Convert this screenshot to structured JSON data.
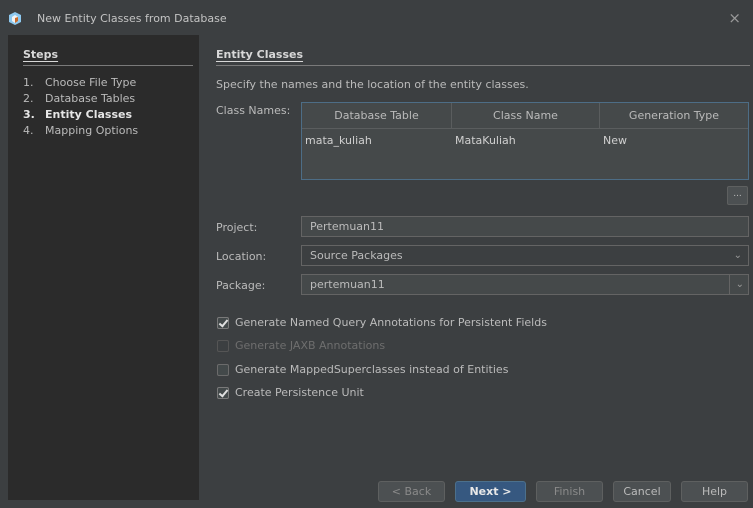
{
  "window": {
    "title": "New Entity Classes from Database",
    "close_icon": "×"
  },
  "steps": {
    "header": "Steps",
    "items": [
      {
        "num": "1.",
        "label": "Choose File Type"
      },
      {
        "num": "2.",
        "label": "Database Tables"
      },
      {
        "num": "3.",
        "label": "Entity Classes"
      },
      {
        "num": "4.",
        "label": "Mapping Options"
      }
    ]
  },
  "main": {
    "header": "Entity Classes",
    "description": "Specify the names and the location of the entity classes.",
    "class_names_label": "Class Names:",
    "table": {
      "columns": [
        "Database Table",
        "Class Name",
        "Generation Type"
      ],
      "rows": [
        {
          "table": "mata_kuliah",
          "class": "MataKuliah",
          "type": "New"
        }
      ]
    },
    "ellipsis_button": "...",
    "project_label": "Project:",
    "project_value": "Pertemuan11",
    "location_label": "Location:",
    "location_value": "Source Packages",
    "package_label": "Package:",
    "package_value": "pertemuan11",
    "checkboxes": [
      {
        "label": "Generate Named Query Annotations for Persistent Fields",
        "checked": true,
        "enabled": true
      },
      {
        "label": "Generate JAXB Annotations",
        "checked": false,
        "enabled": false
      },
      {
        "label": "Generate MappedSuperclasses instead of Entities",
        "checked": false,
        "enabled": true
      },
      {
        "label": "Create Persistence Unit",
        "checked": true,
        "enabled": true
      }
    ]
  },
  "buttons": {
    "back": "< Back",
    "next": "Next >",
    "finish": "Finish",
    "cancel": "Cancel",
    "help": "Help"
  },
  "colors": {
    "background": "#3c3f41",
    "steps_panel": "#2b2b2b",
    "primary_button": "#365880",
    "table_border": "#4d6d86"
  }
}
